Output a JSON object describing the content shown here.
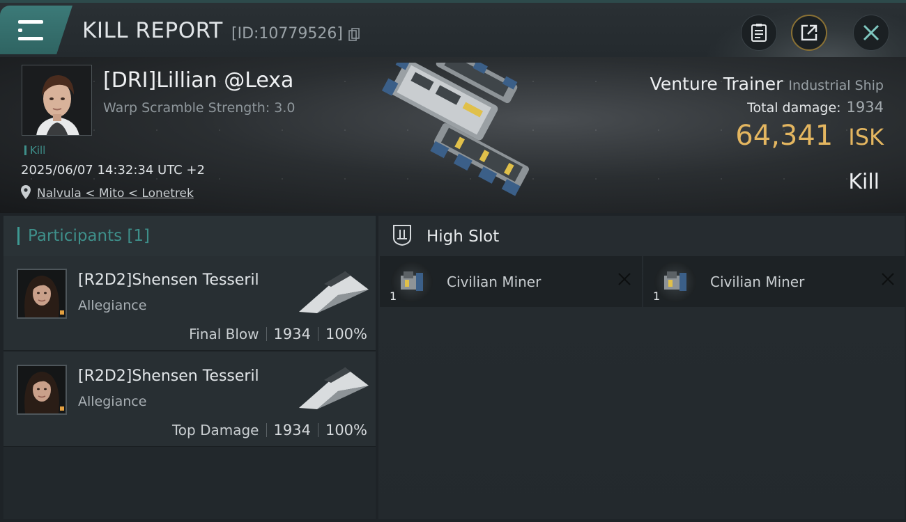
{
  "header": {
    "title": "KILL REPORT",
    "report_id": "[ID:10779526]",
    "buttons": [
      "clipboard-icon",
      "share-icon",
      "close-icon"
    ]
  },
  "victim": {
    "name": "[DRI]Lillian @Lexa",
    "warp_scramble": "Warp Scramble Strength: 3.0",
    "tag": "Kill",
    "datetime": "2025/06/07 14:32:34 UTC +2",
    "location": "Nalvula < Mito < Lonetrek"
  },
  "ship": {
    "name": "Venture Trainer",
    "class": "Industrial Ship",
    "total_damage_label": "Total damage:",
    "total_damage": "1934",
    "isk_value": "64,341",
    "isk_unit": "ISK",
    "outcome": "Kill"
  },
  "participants": {
    "title": "Participants [1]",
    "rows": [
      {
        "name": "[R2D2]Shensen Tesseril",
        "corp": "Allegiance",
        "role": "Final Blow",
        "damage": "1934",
        "percent": "100%"
      },
      {
        "name": "[R2D2]Shensen Tesseril",
        "corp": "Allegiance",
        "role": "Top Damage",
        "damage": "1934",
        "percent": "100%"
      }
    ]
  },
  "fitting": {
    "section": "High Slot",
    "items": [
      {
        "name": "Civilian Miner",
        "qty": "1"
      },
      {
        "name": "Civilian Miner",
        "qty": "1"
      }
    ]
  },
  "colors": {
    "accent_teal": "#3e8f8a",
    "isk_gold": "#e4b660",
    "background": "#1e2327"
  }
}
